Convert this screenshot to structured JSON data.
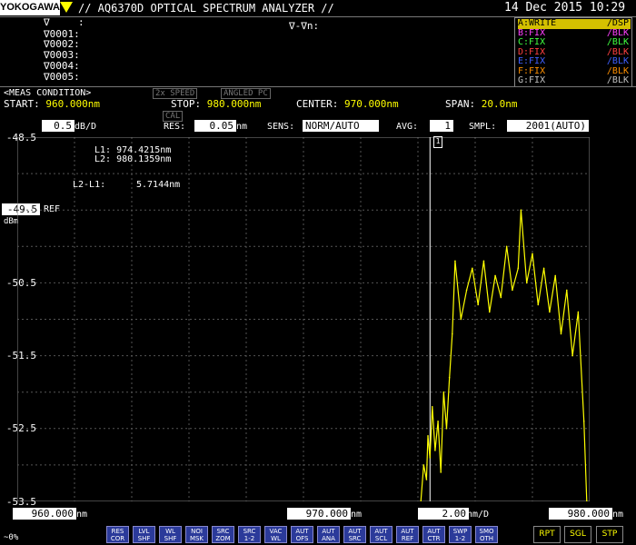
{
  "header": {
    "logo": "YOKOGAWA",
    "title": "// AQ6370D OPTICAL SPECTRUM ANALYZER //",
    "datetime": "14 Dec 2015 10:29"
  },
  "markers": {
    "main": "∇",
    "colon": ":",
    "list": [
      "∇0001:",
      "∇0002:",
      "∇0003:",
      "∇0004:",
      "∇0005:"
    ],
    "delta_label": "∇-∇n:"
  },
  "traces": [
    {
      "left": "A:WRITE",
      "right": "/DSP",
      "color": "#ffff00",
      "bg": "#d4c000",
      "fg": "#000"
    },
    {
      "left": "B:FIX",
      "right": "/BLK",
      "color": "#ff40ff"
    },
    {
      "left": "C:FIX",
      "right": "/BLK",
      "color": "#40ff40"
    },
    {
      "left": "D:FIX",
      "right": "/BLK",
      "color": "#ff4040"
    },
    {
      "left": "E:FIX",
      "right": "/BLK",
      "color": "#4060ff"
    },
    {
      "left": "F:FIX",
      "right": "/BLK",
      "color": "#ff9000"
    },
    {
      "left": "G:FIX",
      "right": "/BLK",
      "color": "#c0c0c0"
    }
  ],
  "meas": {
    "label": "<MEAS CONDITION>",
    "speed": "2x SPEED",
    "angled": "ANGLED PC",
    "start_label": "START:",
    "start": "960.000nm",
    "stop_label": "STOP:",
    "stop": "980.000nm",
    "center_label": "CENTER:",
    "center": "970.000nm",
    "span_label": "SPAN:",
    "span": "20.0nm"
  },
  "settings": {
    "scale": "0.5",
    "scale_unit": "dB/D",
    "cal": "CAL",
    "res_label": "RES:",
    "res": "0.05",
    "res_unit": "nm",
    "sens_label": "SENS:",
    "sens": "NORM/AUTO",
    "avg_label": "AVG:",
    "avg": "1",
    "smpl_label": "SMPL:",
    "smpl": "2001(AUTO)"
  },
  "plot": {
    "y_top": "-48.5",
    "ref_value": "-49.5",
    "ref_label": "REF",
    "ref_unit": "dBm",
    "y_labels": [
      "-50.5",
      "-51.5",
      "-52.5"
    ],
    "y_bottom": "-53.5",
    "marker_tag": "1",
    "readout": {
      "l1": "L1: 974.4215nm",
      "l2": "L2: 980.1359nm",
      "diff_label": "L2-L1:",
      "diff": "5.7144nm"
    }
  },
  "chart_data": {
    "type": "line",
    "xlim": [
      960.0,
      980.0
    ],
    "ylim": [
      -53.5,
      -48.5
    ],
    "grid": true,
    "series": [
      {
        "color": "#ffff00",
        "x": [
          974.1,
          974.2,
          974.3,
          974.35,
          974.42,
          974.5,
          974.6,
          974.7,
          974.8,
          974.9,
          975.0,
          975.1,
          975.2,
          975.3,
          975.5,
          975.7,
          975.9,
          976.1,
          976.3,
          976.5,
          976.7,
          976.9,
          977.1,
          977.3,
          977.5,
          977.6,
          977.8,
          978.0,
          978.2,
          978.4,
          978.6,
          978.8,
          979.0,
          979.2,
          979.4,
          979.6,
          979.8,
          979.9
        ],
        "y": [
          -53.5,
          -53.0,
          -53.2,
          -52.6,
          -52.9,
          -52.2,
          -52.8,
          -52.4,
          -53.1,
          -52.0,
          -52.5,
          -51.8,
          -51.2,
          -50.2,
          -51.0,
          -50.6,
          -50.3,
          -50.8,
          -50.2,
          -50.9,
          -50.4,
          -50.7,
          -50.0,
          -50.6,
          -50.3,
          -49.5,
          -50.5,
          -50.1,
          -50.8,
          -50.3,
          -50.9,
          -50.4,
          -51.2,
          -50.6,
          -51.5,
          -50.9,
          -52.4,
          -53.5
        ]
      }
    ]
  },
  "axis_bottom": {
    "start": "960.000",
    "start_unit": "nm",
    "center": "970.000",
    "center_unit": "nm",
    "div": "2.00",
    "div_unit": "nm/D",
    "stop": "980.000",
    "stop_unit": "nm"
  },
  "progress": "~0%",
  "softkeys": [
    [
      "RES",
      "COR"
    ],
    [
      "LVL",
      "SHF"
    ],
    [
      "WL",
      "SHF"
    ],
    [
      "NOI",
      "MSK"
    ],
    [
      "SRC",
      "ZOM"
    ],
    [
      "SRC",
      "1-2"
    ],
    [
      "VAC",
      "WL"
    ],
    [
      "AUT",
      "OFS"
    ],
    [
      "AUT",
      "ANA"
    ],
    [
      "AUT",
      "SRC"
    ],
    [
      "AUT",
      "SCL"
    ],
    [
      "AUT",
      "REF"
    ],
    [
      "AUT",
      "CTR"
    ],
    [
      "SWP",
      "1-2"
    ],
    [
      "SMO",
      "OTH"
    ]
  ],
  "sweep_buttons": [
    "RPT",
    "SGL",
    "STP"
  ]
}
